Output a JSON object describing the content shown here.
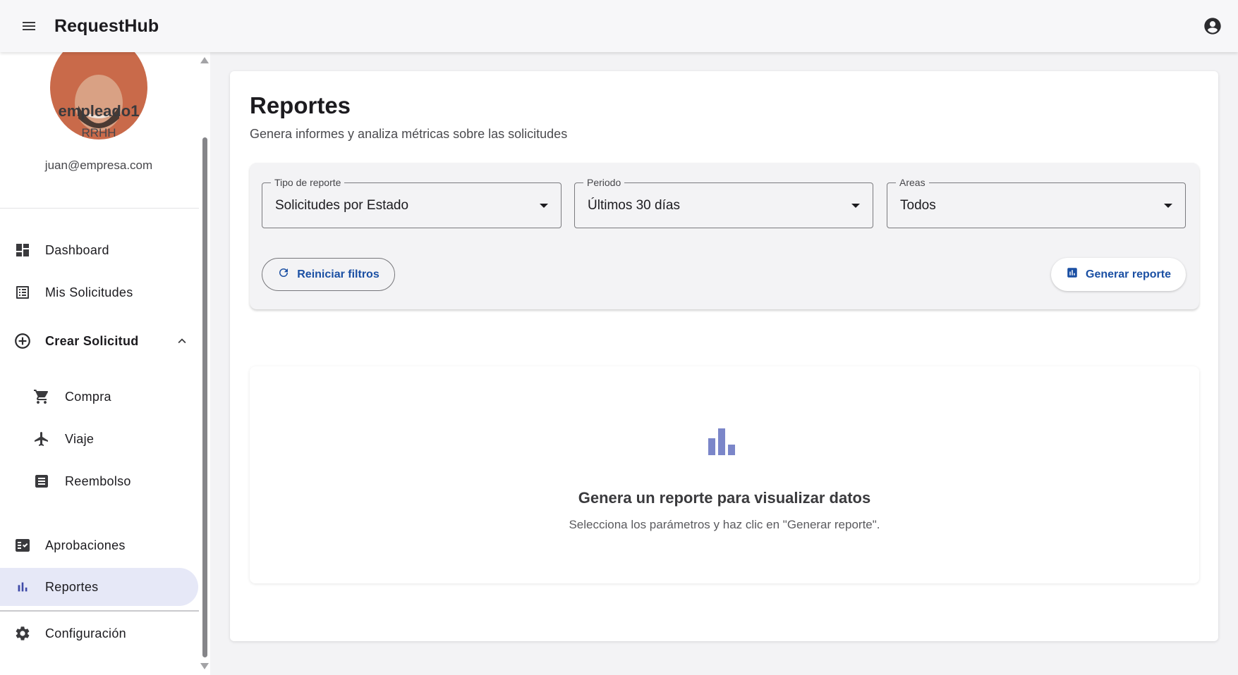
{
  "app": {
    "title": "RequestHub"
  },
  "user": {
    "name": "empleado1",
    "role": "RRHH",
    "email": "juan@empresa.com"
  },
  "sidebar": {
    "items": [
      {
        "label": "Dashboard",
        "icon": "dashboard-icon"
      },
      {
        "label": "Mis Solicitudes",
        "icon": "list-icon"
      },
      {
        "label": "Crear Solicitud",
        "icon": "add-circle-icon",
        "expanded": true
      },
      {
        "label": "Compra",
        "icon": "cart-icon"
      },
      {
        "label": "Viaje",
        "icon": "flight-icon"
      },
      {
        "label": "Reembolso",
        "icon": "receipt-icon"
      },
      {
        "label": "Aprobaciones",
        "icon": "fact-check-icon"
      },
      {
        "label": "Reportes",
        "icon": "bar-chart-icon",
        "active": true
      },
      {
        "label": "Configuración",
        "icon": "gear-icon"
      }
    ]
  },
  "page": {
    "title": "Reportes",
    "subtitle": "Genera informes y analiza métricas sobre las solicitudes"
  },
  "filters": {
    "report_type": {
      "label": "Tipo de reporte",
      "value": "Solicitudes por Estado"
    },
    "period": {
      "label": "Periodo",
      "value": "Últimos 30 días"
    },
    "areas": {
      "label": "Areas",
      "value": "Todos"
    },
    "reset_label": "Reiniciar filtros",
    "generate_label": "Generar reporte"
  },
  "empty_state": {
    "title": "Genera un reporte para visualizar datos",
    "subtitle": "Selecciona los parámetros y haz clic en \"Generar reporte\"."
  },
  "colors": {
    "accent": "#1a4fa3",
    "active_nav_bg": "#e6e8f7",
    "empty_icon": "#7b86c9"
  }
}
